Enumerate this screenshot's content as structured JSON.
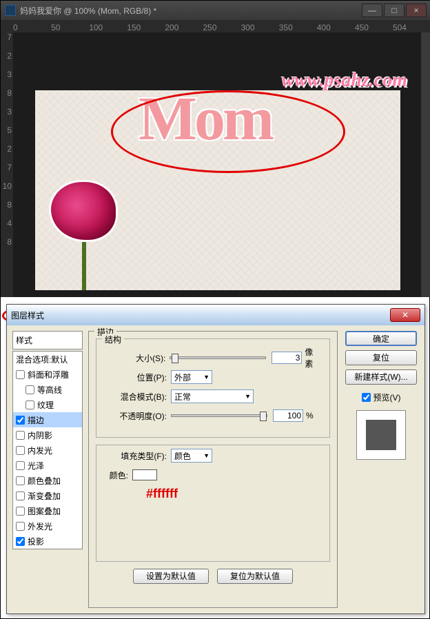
{
  "ps": {
    "title": "妈妈我爱你 @ 100% (Mom, RGB/8) *",
    "ruler_h": [
      "0",
      "50",
      "100",
      "150",
      "200",
      "250",
      "300",
      "350",
      "400",
      "450",
      "504"
    ],
    "ruler_v": [
      "7",
      "2",
      "3",
      "8",
      "3",
      "5",
      "2",
      "7",
      "10",
      "8",
      "4",
      "8"
    ],
    "canvas_text": "Mom",
    "watermark": "www.psahz.com"
  },
  "dialog": {
    "title": "图层样式",
    "styles_header": "样式",
    "blend_default": "混合选项:默认",
    "items": [
      {
        "label": "斜面和浮雕",
        "checked": false,
        "selected": false,
        "indent": false
      },
      {
        "label": "等高线",
        "checked": false,
        "selected": false,
        "indent": true
      },
      {
        "label": "纹理",
        "checked": false,
        "selected": false,
        "indent": true
      },
      {
        "label": "描边",
        "checked": true,
        "selected": true,
        "indent": false
      },
      {
        "label": "内阴影",
        "checked": false,
        "selected": false,
        "indent": false
      },
      {
        "label": "内发光",
        "checked": false,
        "selected": false,
        "indent": false
      },
      {
        "label": "光泽",
        "checked": false,
        "selected": false,
        "indent": false
      },
      {
        "label": "颜色叠加",
        "checked": false,
        "selected": false,
        "indent": false
      },
      {
        "label": "渐变叠加",
        "checked": false,
        "selected": false,
        "indent": false
      },
      {
        "label": "图案叠加",
        "checked": false,
        "selected": false,
        "indent": false
      },
      {
        "label": "外发光",
        "checked": false,
        "selected": false,
        "indent": false
      },
      {
        "label": "投影",
        "checked": true,
        "selected": false,
        "indent": false
      }
    ],
    "panel": {
      "group_title": "描边",
      "structure": "结构",
      "size_label": "大小(S):",
      "size_value": "3",
      "size_unit": "像素",
      "position_label": "位置(P):",
      "position_value": "外部",
      "blend_label": "混合模式(B):",
      "blend_value": "正常",
      "opacity_label": "不透明度(O):",
      "opacity_value": "100",
      "opacity_unit": "%",
      "filltype_label": "填充类型(F):",
      "filltype_value": "颜色",
      "color_label": "颜色:",
      "color_hex": "#ffffff",
      "set_default": "设置为默认值",
      "reset_default": "复位为默认值"
    },
    "buttons": {
      "ok": "确定",
      "cancel": "复位",
      "newstyle": "新建样式(W)...",
      "preview": "预览(V)"
    }
  }
}
